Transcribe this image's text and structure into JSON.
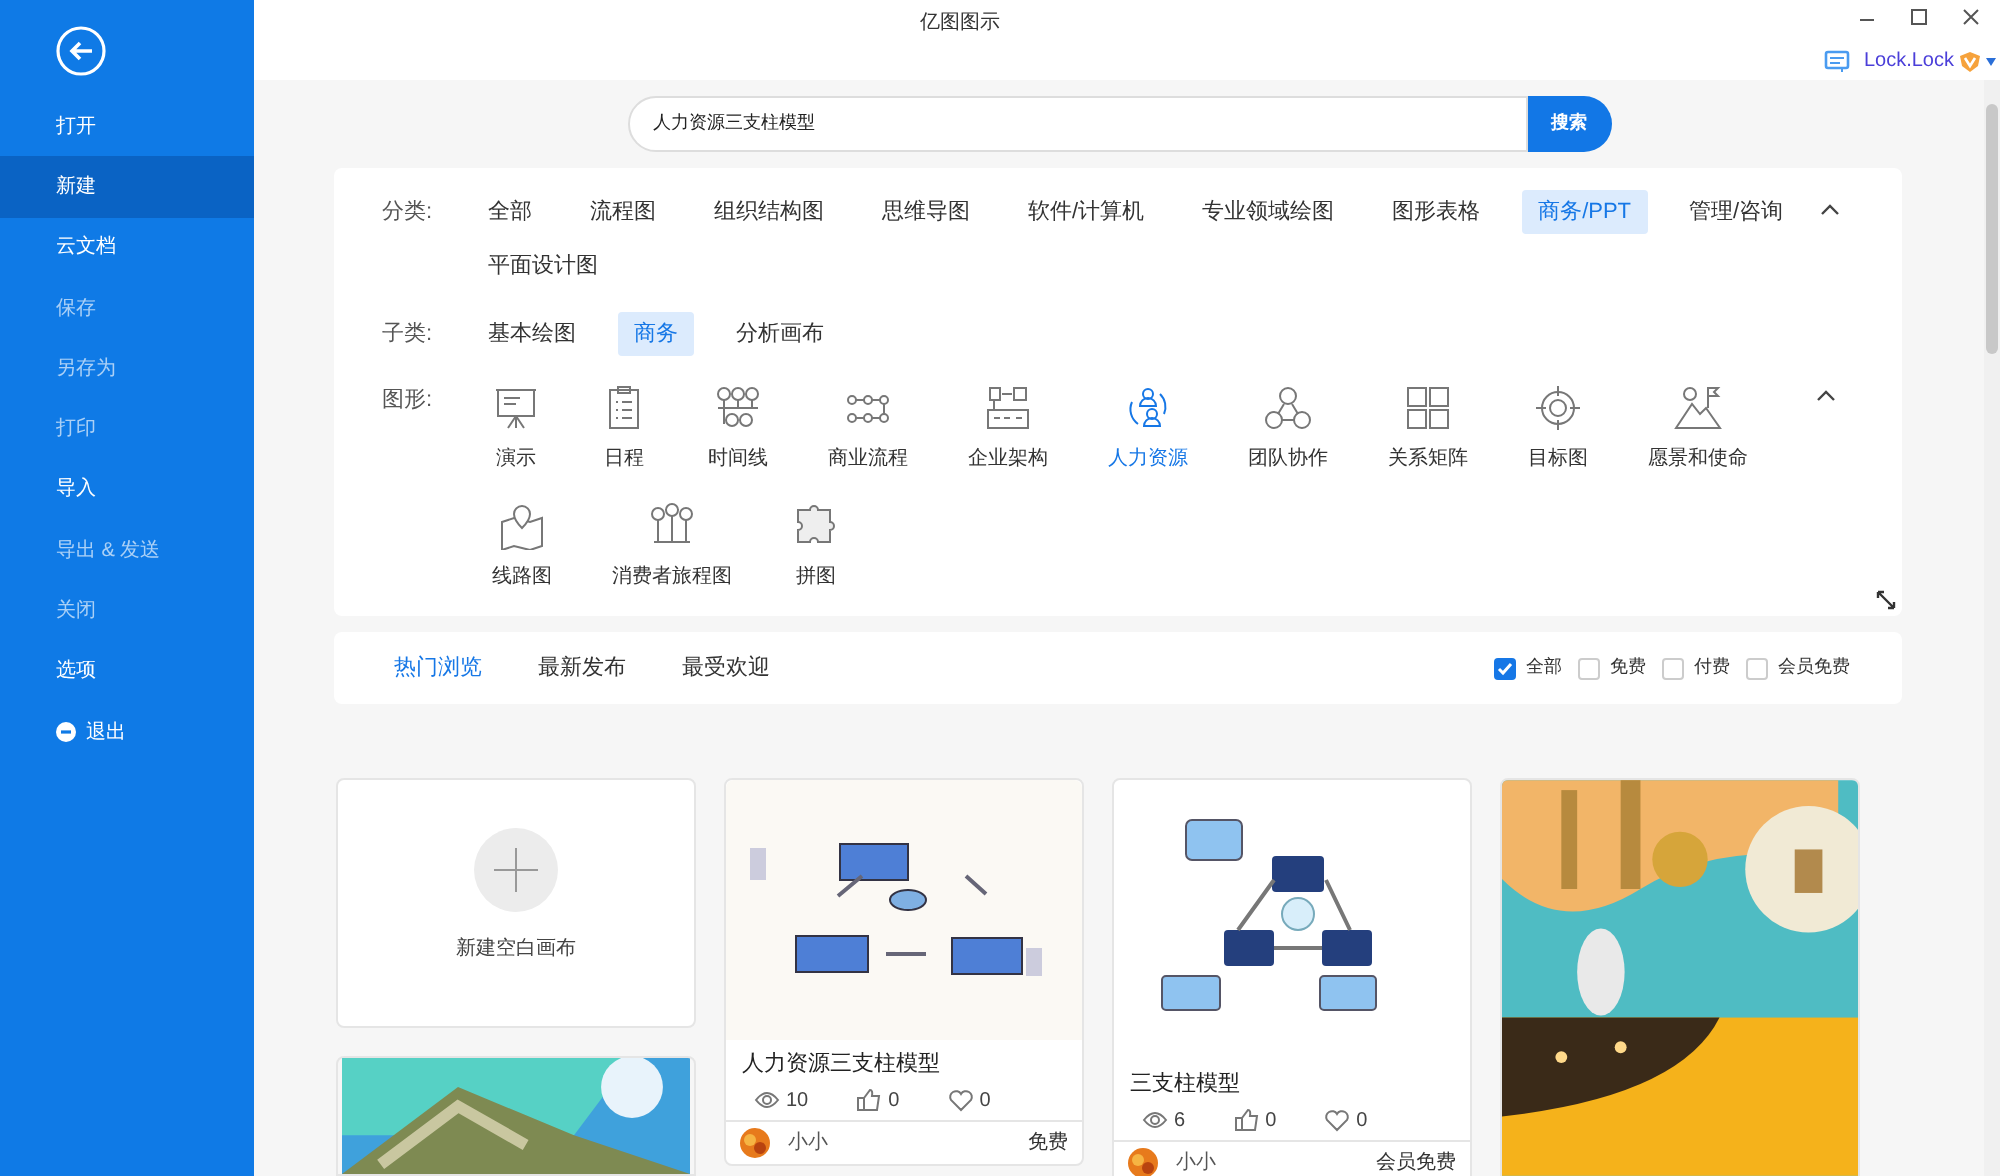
{
  "window": {
    "title": "亿图图示"
  },
  "sidebar": {
    "items": [
      {
        "label": "打开",
        "kind": "item",
        "selected": false,
        "disabled": false
      },
      {
        "label": "新建",
        "kind": "item",
        "selected": true,
        "disabled": false
      },
      {
        "label": "云文档",
        "kind": "item",
        "selected": false,
        "disabled": false
      },
      {
        "label": "保存",
        "kind": "item",
        "selected": false,
        "disabled": true
      },
      {
        "label": "另存为",
        "kind": "item",
        "selected": false,
        "disabled": true
      },
      {
        "label": "打印",
        "kind": "item",
        "selected": false,
        "disabled": true
      },
      {
        "label": "导入",
        "kind": "item",
        "selected": false,
        "disabled": false
      },
      {
        "label": "导出 & 发送",
        "kind": "item",
        "selected": false,
        "disabled": true
      },
      {
        "label": "关闭",
        "kind": "item",
        "selected": false,
        "disabled": true
      },
      {
        "label": "选项",
        "kind": "item",
        "selected": false,
        "disabled": false
      },
      {
        "label": "退出",
        "kind": "exit",
        "selected": false,
        "disabled": false
      }
    ]
  },
  "user": {
    "name": "Lock.Lock"
  },
  "search": {
    "value": "人力资源三支柱模型",
    "button": "搜索"
  },
  "filters": {
    "category": {
      "label": "分类:",
      "options": [
        {
          "label": "全部",
          "selected": false
        },
        {
          "label": "流程图",
          "selected": false
        },
        {
          "label": "组织结构图",
          "selected": false
        },
        {
          "label": "思维导图",
          "selected": false
        },
        {
          "label": "软件/计算机",
          "selected": false
        },
        {
          "label": "专业领域绘图",
          "selected": false
        },
        {
          "label": "图形表格",
          "selected": false
        },
        {
          "label": "商务/PPT",
          "selected": true
        },
        {
          "label": "管理/咨询",
          "selected": false
        },
        {
          "label": "平面设计图",
          "selected": false
        }
      ]
    },
    "subcategory": {
      "label": "子类:",
      "options": [
        {
          "label": "基本绘图",
          "selected": false
        },
        {
          "label": "商务",
          "selected": true
        },
        {
          "label": "分析画布",
          "selected": false
        }
      ]
    },
    "shapes": {
      "label": "图形:",
      "options": [
        {
          "label": "演示",
          "selected": false
        },
        {
          "label": "日程",
          "selected": false
        },
        {
          "label": "时间线",
          "selected": false
        },
        {
          "label": "商业流程",
          "selected": false
        },
        {
          "label": "企业架构",
          "selected": false
        },
        {
          "label": "人力资源",
          "selected": true
        },
        {
          "label": "团队协作",
          "selected": false
        },
        {
          "label": "关系矩阵",
          "selected": false
        },
        {
          "label": "目标图",
          "selected": false
        },
        {
          "label": "愿景和使命",
          "selected": false
        },
        {
          "label": "线路图",
          "selected": false
        },
        {
          "label": "消费者旅程图",
          "selected": false
        },
        {
          "label": "拼图",
          "selected": false
        }
      ]
    }
  },
  "sort_tabs": [
    {
      "label": "热门浏览",
      "selected": true
    },
    {
      "label": "最新发布",
      "selected": false
    },
    {
      "label": "最受欢迎",
      "selected": false
    }
  ],
  "price_filters": [
    {
      "label": "全部",
      "checked": true
    },
    {
      "label": "免费",
      "checked": false
    },
    {
      "label": "付费",
      "checked": false
    },
    {
      "label": "会员免费",
      "checked": false
    }
  ],
  "card_columns": [
    [
      {
        "kind": "new",
        "label": "新建空白画布"
      },
      {
        "kind": "picture"
      }
    ],
    [
      {
        "kind": "template",
        "title": "人力资源三支柱模型",
        "views": "10",
        "likes": "0",
        "favorites": "0",
        "author": "小小",
        "price": "免费"
      }
    ],
    [
      {
        "kind": "template",
        "title": "三支柱模型",
        "views": "6",
        "likes": "0",
        "favorites": "0",
        "author": "小小",
        "price": "会员免费"
      }
    ],
    [
      {
        "kind": "picture"
      }
    ]
  ]
}
